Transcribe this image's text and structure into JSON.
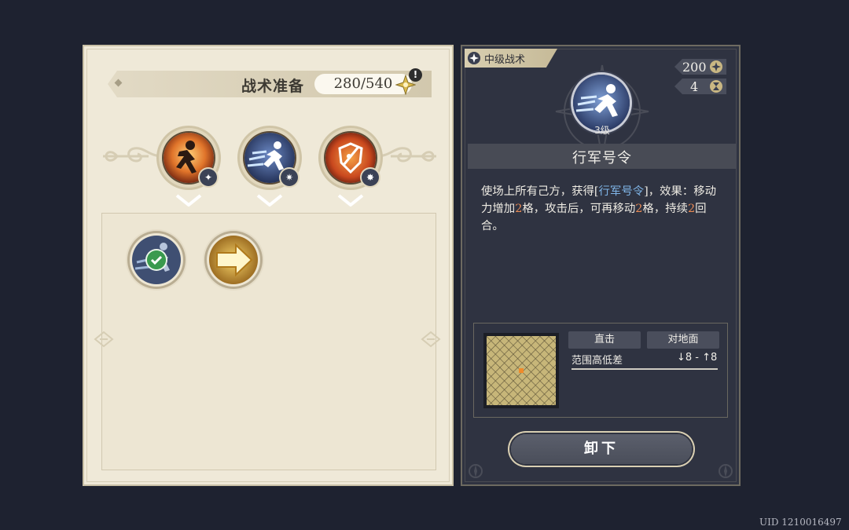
{
  "left_panel": {
    "title": "战术准备",
    "points": "280/540",
    "alert_symbol": "!",
    "equipped_slots": [
      {
        "name": "orange-runner",
        "badge": "✦"
      },
      {
        "name": "blue-sprinter",
        "badge": "✷"
      },
      {
        "name": "fire-shield",
        "badge": "✸"
      }
    ],
    "inventory": [
      {
        "name": "equipped-sprinter",
        "equipped": true
      },
      {
        "name": "golden-arrow",
        "equipped": false
      }
    ]
  },
  "right_panel": {
    "rank_label": "中级战术",
    "cost_value": "200",
    "turns_value": "4",
    "level_label": "3级",
    "skill_name": "行军号令",
    "description": {
      "p1": "使场上所有己方，获得[",
      "link": "行军号令",
      "p2": "]，效果：移动力增加",
      "n1": "2",
      "p3": "格，攻击后，可再移动",
      "n2": "2",
      "p4": "格，持续",
      "n3": "2",
      "p5": "回合。"
    },
    "range": {
      "tag_1": "直击",
      "tag_2": "对地面",
      "label": "范围高低差",
      "value": "↓8 - ↑8"
    },
    "unequip_label": "卸下"
  },
  "uid_text": "UID 1210016497",
  "colors": {
    "background": "#1e2230",
    "left_panel": "#efe9d8",
    "right_panel": "#2f3341",
    "highlight_blue": "#7fb4e6",
    "highlight_orange": "#e98a54",
    "gold": "#d9b84a"
  }
}
